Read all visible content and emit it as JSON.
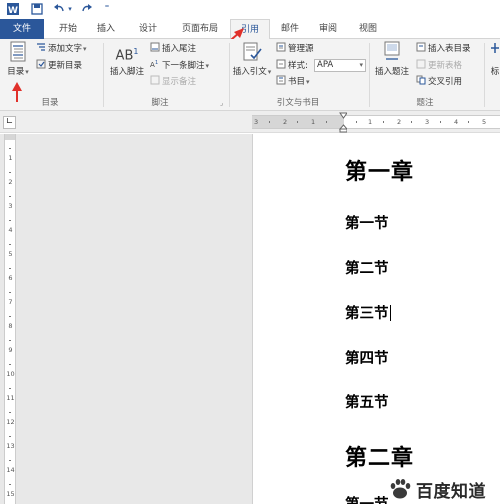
{
  "quick_access": {
    "icons": [
      "word-app-icon",
      "save-icon",
      "undo-icon",
      "redo-icon"
    ]
  },
  "tabs": [
    {
      "label": "文件"
    },
    {
      "label": "开始"
    },
    {
      "label": "插入"
    },
    {
      "label": "设计"
    },
    {
      "label": "页面布局"
    },
    {
      "label": "引用"
    },
    {
      "label": "邮件"
    },
    {
      "label": "审阅"
    },
    {
      "label": "视图"
    }
  ],
  "ribbon": {
    "toc_group": {
      "label": "目录",
      "toc_button": "目录",
      "add_text": "添加文字",
      "update_toc": "更新目录"
    },
    "footnote_group": {
      "label": "脚注",
      "insert_footnote": "插入脚注",
      "ab_glyph": "AB",
      "superscript": "1",
      "insert_endnote": "插入尾注",
      "next_footnote": "下一条脚注",
      "show_notes": "显示备注"
    },
    "citation_group": {
      "label": "引文与书目",
      "insert_citation": "插入引文",
      "manage_sources": "管理源",
      "style_label": "样式:",
      "style_value": "APA",
      "bibliography": "书目"
    },
    "caption_group": {
      "label": "题注",
      "insert_caption": "插入题注",
      "insert_table_of_figures": "插入表目录",
      "update_table": "更新表格",
      "cross_reference": "交叉引用"
    },
    "index_group": {
      "label": "标"
    }
  },
  "ruler": {
    "numbers": [
      "3",
      "2",
      "1",
      "1",
      "2",
      "3",
      "4",
      "5",
      "6",
      "7"
    ]
  },
  "vruler": {
    "numbers": [
      "1",
      "2",
      "3",
      "4",
      "5",
      "6",
      "7",
      "8",
      "9",
      "10",
      "11",
      "12",
      "13",
      "14",
      "15"
    ]
  },
  "document": {
    "lines": [
      {
        "text": "第一章",
        "level": 1
      },
      {
        "text": "第一节",
        "level": 2
      },
      {
        "text": "第二节",
        "level": 2
      },
      {
        "text": "第三节",
        "level": 2,
        "cursor": true
      },
      {
        "text": "第四节",
        "level": 2
      },
      {
        "text": "第五节",
        "level": 2
      },
      {
        "text": "第二章",
        "level": 1
      },
      {
        "text": "第一节",
        "level": 2
      }
    ]
  },
  "watermark": {
    "text": "百度知道"
  },
  "colors": {
    "accent": "#2b579a",
    "arrow": "#e0302a"
  }
}
